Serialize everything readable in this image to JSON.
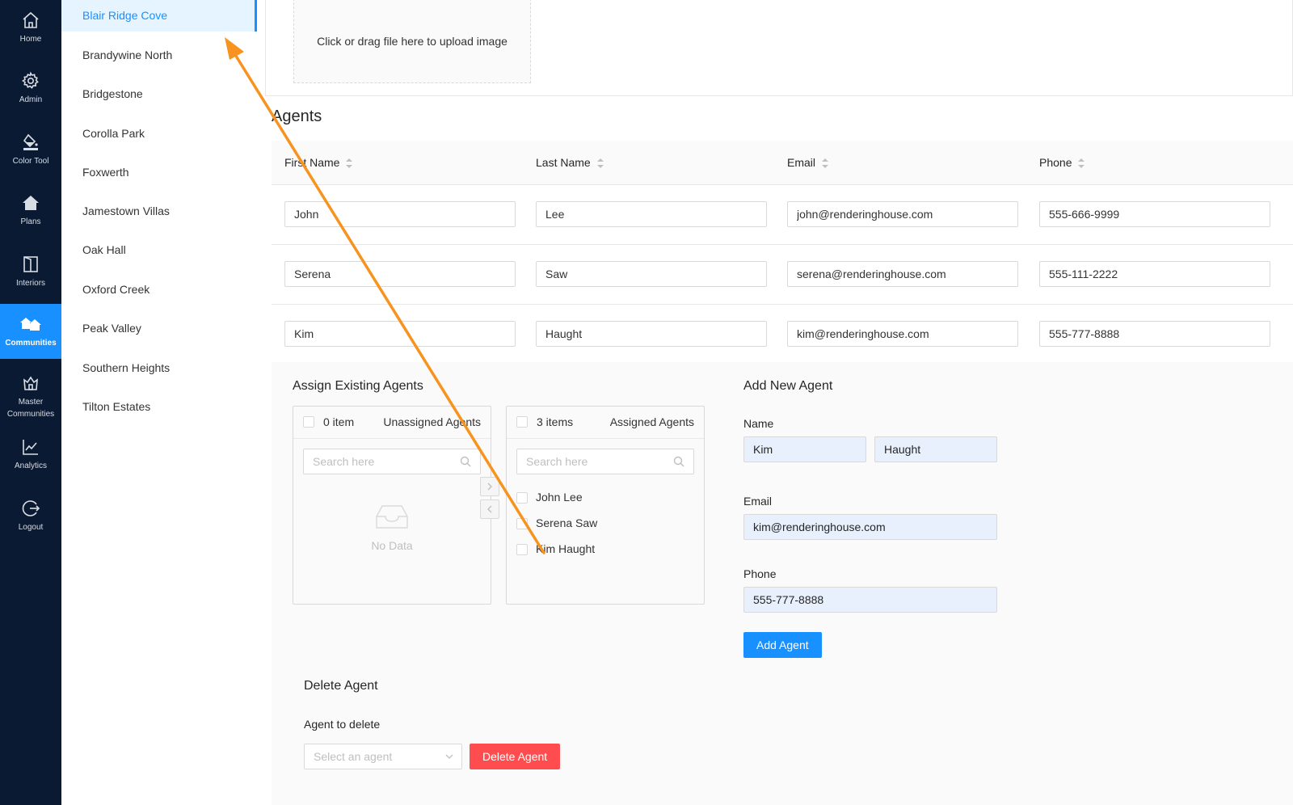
{
  "nav": [
    {
      "label": "Home",
      "icon": "home-icon"
    },
    {
      "label": "Admin",
      "icon": "gear-icon"
    },
    {
      "label": "Color Tool",
      "icon": "paint-bucket-icon"
    },
    {
      "label": "Plans",
      "icon": "house-icon"
    },
    {
      "label": "Interiors",
      "icon": "door-icon"
    },
    {
      "label": "Communities",
      "icon": "communities-icon",
      "active": true
    },
    {
      "label": "Master\nCommunities",
      "icon": "crown-house-icon"
    },
    {
      "label": "Analytics",
      "icon": "line-chart-icon"
    },
    {
      "label": "Logout",
      "icon": "logout-icon"
    }
  ],
  "communities": [
    "Blair Ridge Cove",
    "Brandywine North",
    "Bridgestone",
    "Corolla Park",
    "Foxwerth",
    "Jamestown Villas",
    "Oak Hall",
    "Oxford Creek",
    "Peak Valley",
    "Southern Heights",
    "Tilton Estates"
  ],
  "upload": {
    "text": "Click or drag file here to upload image"
  },
  "agents": {
    "title": "Agents",
    "columns": [
      "First Name",
      "Last Name",
      "Email",
      "Phone"
    ],
    "rows": [
      [
        "John",
        "Lee",
        "john@renderinghouse.com",
        "555-666-9999"
      ],
      [
        "Serena",
        "Saw",
        "serena@renderinghouse.com",
        "555-111-2222"
      ],
      [
        "Kim",
        "Haught",
        "kim@renderinghouse.com",
        "555-777-8888"
      ]
    ]
  },
  "assign": {
    "title": "Assign Existing Agents",
    "left": {
      "count": "0 item",
      "title": "Unassigned Agents",
      "search_placeholder": "Search here",
      "empty": "No Data"
    },
    "right": {
      "count": "3 items",
      "title": "Assigned Agents",
      "search_placeholder": "Search here",
      "items": [
        "John Lee",
        "Serena Saw",
        "Kim Haught"
      ]
    }
  },
  "add_agent": {
    "title": "Add New Agent",
    "name_label": "Name",
    "first": "Kim",
    "last": "Haught",
    "email_label": "Email",
    "email": "kim@renderinghouse.com",
    "phone_label": "Phone",
    "phone": "555-777-8888",
    "button": "Add Agent"
  },
  "delete_agent": {
    "title": "Delete Agent",
    "label": "Agent to delete",
    "placeholder": "Select an agent",
    "button": "Delete Agent"
  },
  "colors": {
    "nav_bg": "#0b1a33",
    "accent": "#1890ff",
    "danger": "#ff4d4f",
    "annotation": "#f7931e"
  }
}
